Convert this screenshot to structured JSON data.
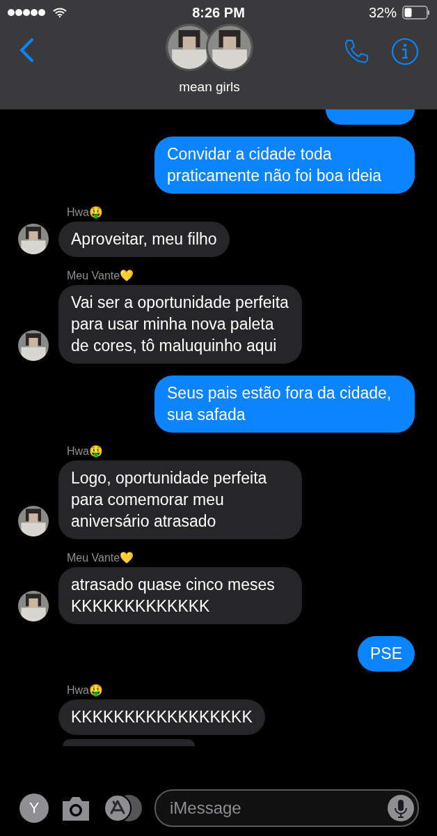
{
  "status_bar": {
    "time": "8:26 PM",
    "battery": "32%"
  },
  "header": {
    "title": "mean girls"
  },
  "messages": [
    {
      "kind": "sent_cut"
    },
    {
      "kind": "sent",
      "text": "Convidar a cidade toda praticamente não foi boa ideia"
    },
    {
      "kind": "received",
      "sender": "Hwa🤑",
      "text": "Aproveitar, meu filho"
    },
    {
      "kind": "received",
      "sender": "Meu Vante💛",
      "text": "Vai ser a oportunidade perfeita para usar minha nova paleta de cores, tô maluquinho aqui"
    },
    {
      "kind": "sent",
      "text": "Seus pais estão fora da cidade, sua safada"
    },
    {
      "kind": "received",
      "sender": "Hwa🤑",
      "text": "Logo, oportunidade perfeita para comemorar meu aniversário atrasado"
    },
    {
      "kind": "received",
      "sender": "Meu Vante💛",
      "text": "atrasado quase cinco meses KKKKKKKKKKKKK"
    },
    {
      "kind": "sent",
      "text": "PSE"
    },
    {
      "kind": "received",
      "sender": "Hwa🤑",
      "text": "KKKKKKKKKKKKKKKKK",
      "avatar": false
    },
    {
      "kind": "received_cut"
    }
  ],
  "composer": {
    "profile_initial": "Y",
    "placeholder": "iMessage"
  }
}
